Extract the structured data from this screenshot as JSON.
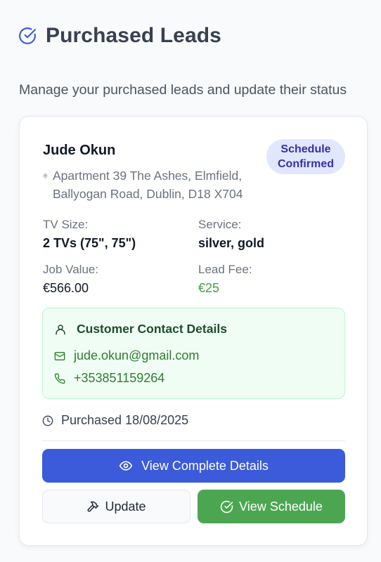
{
  "page": {
    "title": "Purchased Leads",
    "title_icon": "circle-check-icon",
    "subtitle": "Manage your purchased leads and update their status"
  },
  "lead": {
    "name": "Jude Okun",
    "status_line1": "Schedule",
    "status_line2": "Confirmed",
    "address_icon": "map-pin-icon",
    "address": "Apartment 39 The Ashes, Elmfield, Ballyogan Road, Dublin, D18 X704",
    "tv_size_label": "TV Size:",
    "tv_size_value": "2 TVs (75\", 75\")",
    "service_label": "Service:",
    "service_value": "silver, gold",
    "job_value_label": "Job Value:",
    "job_value": "€566.00",
    "lead_fee_label": "Lead Fee:",
    "lead_fee": "€25",
    "contact": {
      "title": "Customer Contact Details",
      "title_icon": "user-icon",
      "email_icon": "mail-icon",
      "email": "jude.okun@gmail.com",
      "phone_icon": "phone-icon",
      "phone": "+353851159264"
    },
    "purchased_icon": "clock-icon",
    "purchased": "Purchased 18/08/2025"
  },
  "actions": {
    "view_details": "View Complete Details",
    "view_details_icon": "eye-icon",
    "update": "Update",
    "update_icon": "hammer-icon",
    "view_schedule": "View Schedule",
    "view_schedule_icon": "circle-check-icon"
  },
  "colors": {
    "accent_blue": "#3b5bdb",
    "success_green": "#4ca651",
    "badge_bg": "#e0e7ff",
    "badge_text": "#3730a3",
    "fee_green": "#43a047"
  }
}
